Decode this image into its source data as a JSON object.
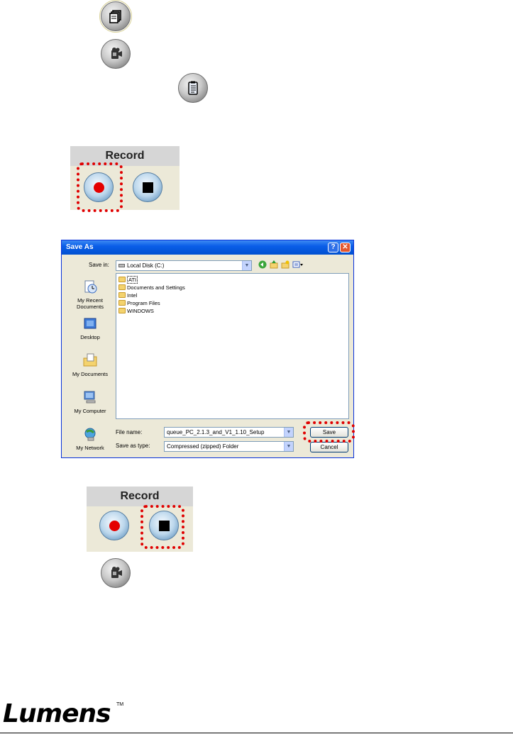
{
  "record_panel": {
    "title": "Record"
  },
  "dialog": {
    "title": "Save As",
    "help_glyph": "?",
    "close_glyph": "✕",
    "save_in_label": "Save in:",
    "save_in_value": "Local Disk (C:)",
    "places": [
      {
        "label": "My Recent Documents",
        "icon": "recent-documents-icon"
      },
      {
        "label": "Desktop",
        "icon": "desktop-icon"
      },
      {
        "label": "My Documents",
        "icon": "my-documents-icon"
      },
      {
        "label": "My Computer",
        "icon": "my-computer-icon"
      },
      {
        "label": "My Network",
        "icon": "my-network-icon"
      }
    ],
    "files": [
      "ATI",
      "Documents and Settings",
      "Intel",
      "Program Files",
      "WINDOWS"
    ],
    "file_name_label": "File name:",
    "file_name_value": "queue_PC_2.1.3_and_V1_1.10_Setup",
    "save_as_type_label": "Save as type:",
    "save_as_type_value": "Compressed (zipped) Folder",
    "save_button": "Save",
    "cancel_button": "Cancel"
  },
  "logo": {
    "text": "Lumens",
    "tm": "TM"
  },
  "colors": {
    "highlight": "#e00000",
    "xp_title": "#0a5ee8",
    "panel": "#ece9d8"
  }
}
